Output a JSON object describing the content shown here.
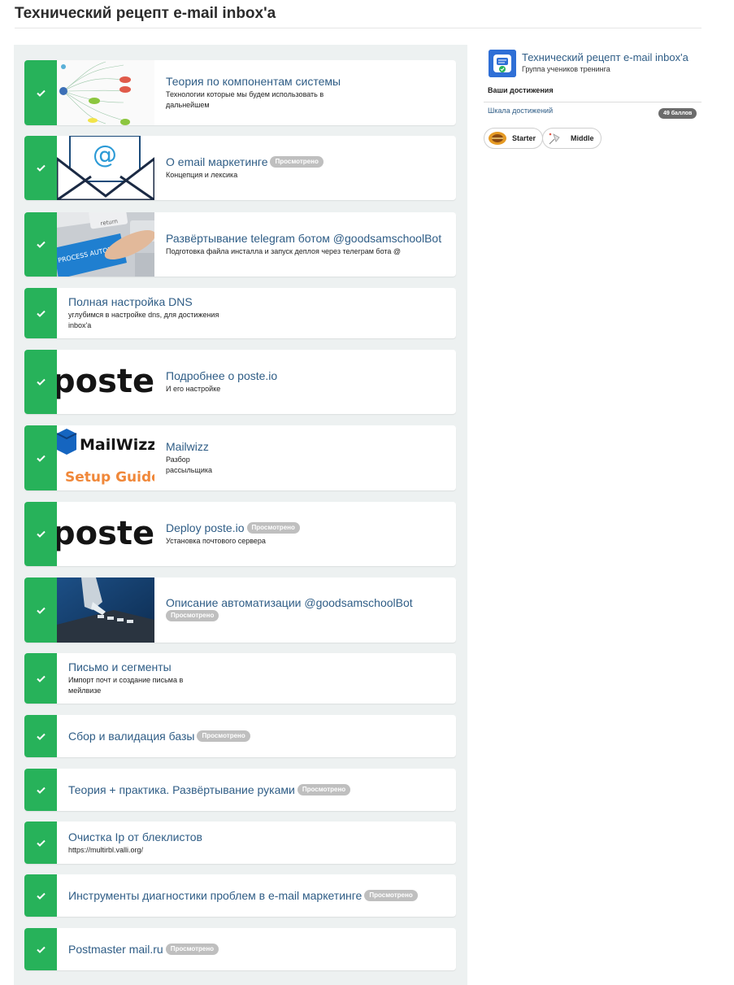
{
  "page": {
    "title": "Технический рецепт e-mail inbox'a"
  },
  "lessons": [
    {
      "title": "Теория по компонентам системы",
      "desc_lines": [
        "Технологии которые мы будем использовать в",
        "дальнейшем"
      ],
      "badge": ""
    },
    {
      "title": "О email маркетинге",
      "desc_lines": [
        "Концепция и лексика"
      ],
      "badge": "Просмотрено"
    },
    {
      "title": "Развёртывание telegram ботом @goodsamschoolBot",
      "desc_lines": [
        "Подготовка файла инсталла и запуск деплоя через телеграм бота @"
      ],
      "badge": ""
    },
    {
      "title": "Полная настройка DNS",
      "desc_lines": [
        "углубимся в настройке dns, для достижения",
        "inbox'a"
      ],
      "badge": ""
    },
    {
      "title": "Подробнее о poste.io",
      "desc_lines": [
        "И его настройке"
      ],
      "badge": ""
    },
    {
      "title": "Mailwizz",
      "desc_lines": [
        "Разбор",
        "рассыльщика"
      ],
      "badge": ""
    },
    {
      "title": "Deploy poste.io",
      "desc_lines": [
        "Установка почтового сервера"
      ],
      "badge": "Просмотрено"
    },
    {
      "title": "Описание автоматизации @goodsamschoolBot",
      "desc_lines": [],
      "badge": "Просмотрено"
    },
    {
      "title": "Письмо и сегменты",
      "desc_lines": [
        "Импорт почт и создание письма в",
        "мейлвизе"
      ],
      "badge": ""
    },
    {
      "title": "Сбор и валидация базы",
      "desc_lines": [],
      "badge": "Просмотрено"
    },
    {
      "title": "Теория + практика. Развёртывание руками",
      "desc_lines": [],
      "badge": "Просмотрено"
    },
    {
      "title": "Очистка Ip от блеклистов",
      "desc_lines": [
        "https://multirbl.valli.org/"
      ],
      "badge": ""
    },
    {
      "title": "Инструменты диагностики проблем в e-mail маркетинге",
      "desc_lines": [],
      "badge": "Просмотрено"
    },
    {
      "title": "Postmaster mail.ru",
      "desc_lines": [],
      "badge": "Просмотрено"
    }
  ],
  "thumbnails": {
    "mailwizz_brand": "MailWizz",
    "mailwizz_caption": "Setup Guide",
    "poste_logo": "poste.i",
    "keyboard_key": "return",
    "keyboard_banner": "PROCESS AUTOMATION"
  },
  "sidebar": {
    "group_name": "Технический рецепт e-mail inbox'a",
    "group_subtitle": "Группа учеников тренинга",
    "achievements_title": "Ваши достижения",
    "scale_link": "Шкала достижений",
    "points": "49 баллов",
    "achievements": [
      {
        "label": "Starter"
      },
      {
        "label": "Middle"
      }
    ]
  },
  "colors": {
    "accent_green": "#27b25a",
    "link_blue": "#2f5d86",
    "panel_bg": "#edf1f1",
    "badge_grey": "#bfbfbf"
  }
}
